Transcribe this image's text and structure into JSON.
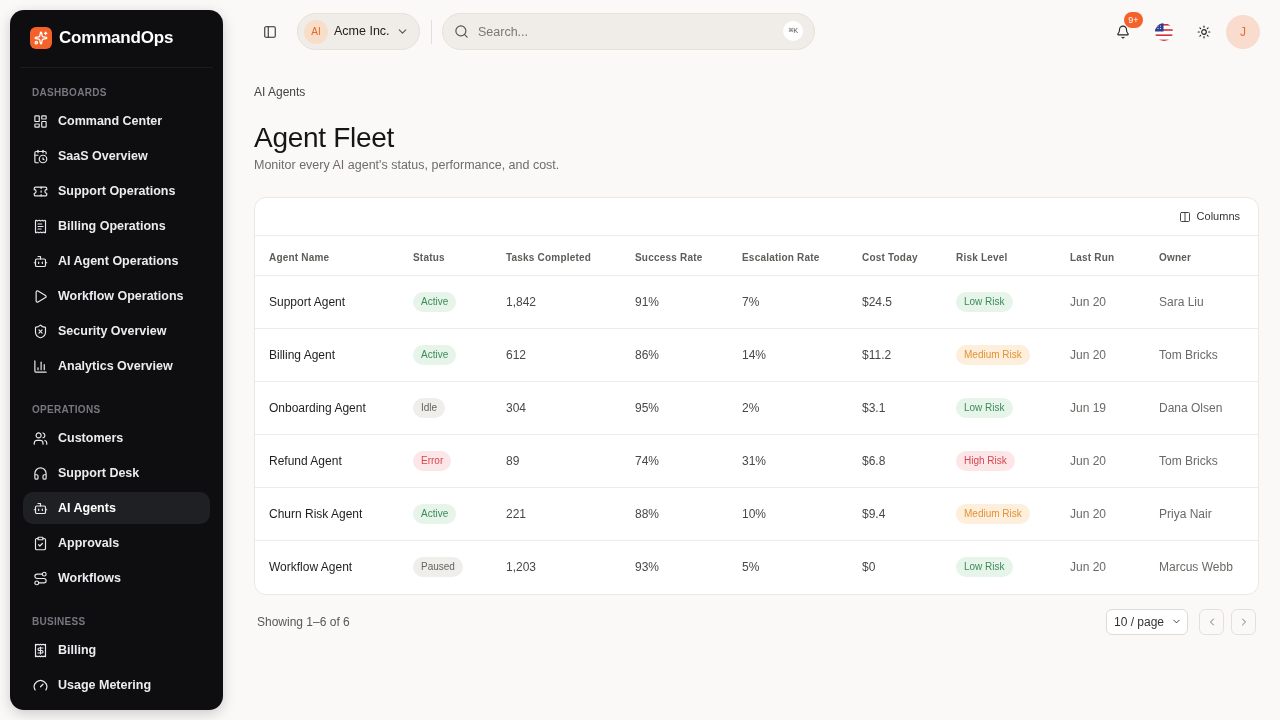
{
  "sidebar": {
    "brand": "CommandOps",
    "sections": [
      {
        "title": "DASHBOARDS",
        "items": [
          {
            "label": "Command Center",
            "selected": false
          },
          {
            "label": "SaaS Overview",
            "selected": false
          },
          {
            "label": "Support Operations",
            "selected": false
          },
          {
            "label": "Billing Operations",
            "selected": false
          },
          {
            "label": "AI Agent Operations",
            "selected": false
          },
          {
            "label": "Workflow Operations",
            "selected": false
          },
          {
            "label": "Security Overview",
            "selected": false
          },
          {
            "label": "Analytics Overview",
            "selected": false
          }
        ]
      },
      {
        "title": "OPERATIONS",
        "items": [
          {
            "label": "Customers",
            "selected": false
          },
          {
            "label": "Support Desk",
            "selected": false
          },
          {
            "label": "AI Agents",
            "selected": true
          },
          {
            "label": "Approvals",
            "selected": false
          },
          {
            "label": "Workflows",
            "selected": false
          }
        ]
      },
      {
        "title": "BUSINESS",
        "items": [
          {
            "label": "Billing",
            "selected": false
          },
          {
            "label": "Usage Metering",
            "selected": false
          }
        ]
      }
    ]
  },
  "topbar": {
    "org": {
      "initials": "AI",
      "name": "Acme Inc."
    },
    "search": {
      "placeholder": "Search...",
      "shortcut": "⌘K"
    },
    "notifications": {
      "badge": "9+"
    },
    "user": {
      "initial": "J"
    }
  },
  "page": {
    "breadcrumb": "AI Agents",
    "title": "Agent Fleet",
    "subtitle": "Monitor every AI agent's status, performance, and cost."
  },
  "table": {
    "toolbar_button": "Columns",
    "columns": [
      "Agent Name",
      "Status",
      "Tasks Completed",
      "Success Rate",
      "Escalation Rate",
      "Cost Today",
      "Risk Level",
      "Last Run",
      "Owner"
    ],
    "rows": [
      {
        "agent": "Support Agent",
        "status": {
          "label": "Active",
          "kind": "success"
        },
        "tasks": "1,842",
        "success_rate": "91%",
        "escalation_rate": "7%",
        "cost": "$24.5",
        "risk": {
          "label": "Low Risk",
          "kind": "success"
        },
        "last_run": "Jun 20",
        "owner": "Sara Liu"
      },
      {
        "agent": "Billing Agent",
        "status": {
          "label": "Active",
          "kind": "success"
        },
        "tasks": "612",
        "success_rate": "86%",
        "escalation_rate": "14%",
        "cost": "$11.2",
        "risk": {
          "label": "Medium Risk",
          "kind": "warning"
        },
        "last_run": "Jun 20",
        "owner": "Tom Bricks"
      },
      {
        "agent": "Onboarding Agent",
        "status": {
          "label": "Idle",
          "kind": "neutral"
        },
        "tasks": "304",
        "success_rate": "95%",
        "escalation_rate": "2%",
        "cost": "$3.1",
        "risk": {
          "label": "Low Risk",
          "kind": "success"
        },
        "last_run": "Jun 19",
        "owner": "Dana Olsen"
      },
      {
        "agent": "Refund Agent",
        "status": {
          "label": "Error",
          "kind": "danger"
        },
        "tasks": "89",
        "success_rate": "74%",
        "escalation_rate": "31%",
        "cost": "$6.8",
        "risk": {
          "label": "High Risk",
          "kind": "danger"
        },
        "last_run": "Jun 20",
        "owner": "Tom Bricks"
      },
      {
        "agent": "Churn Risk Agent",
        "status": {
          "label": "Active",
          "kind": "success"
        },
        "tasks": "221",
        "success_rate": "88%",
        "escalation_rate": "10%",
        "cost": "$9.4",
        "risk": {
          "label": "Medium Risk",
          "kind": "warning"
        },
        "last_run": "Jun 20",
        "owner": "Priya Nair"
      },
      {
        "agent": "Workflow Agent",
        "status": {
          "label": "Paused",
          "kind": "neutral"
        },
        "tasks": "1,203",
        "success_rate": "93%",
        "escalation_rate": "5%",
        "cost": "$0",
        "risk": {
          "label": "Low Risk",
          "kind": "success"
        },
        "last_run": "Jun 20",
        "owner": "Marcus Webb"
      }
    ]
  },
  "footer": {
    "summary": "Showing 1–6 of 6",
    "page_size": "10 / page"
  }
}
